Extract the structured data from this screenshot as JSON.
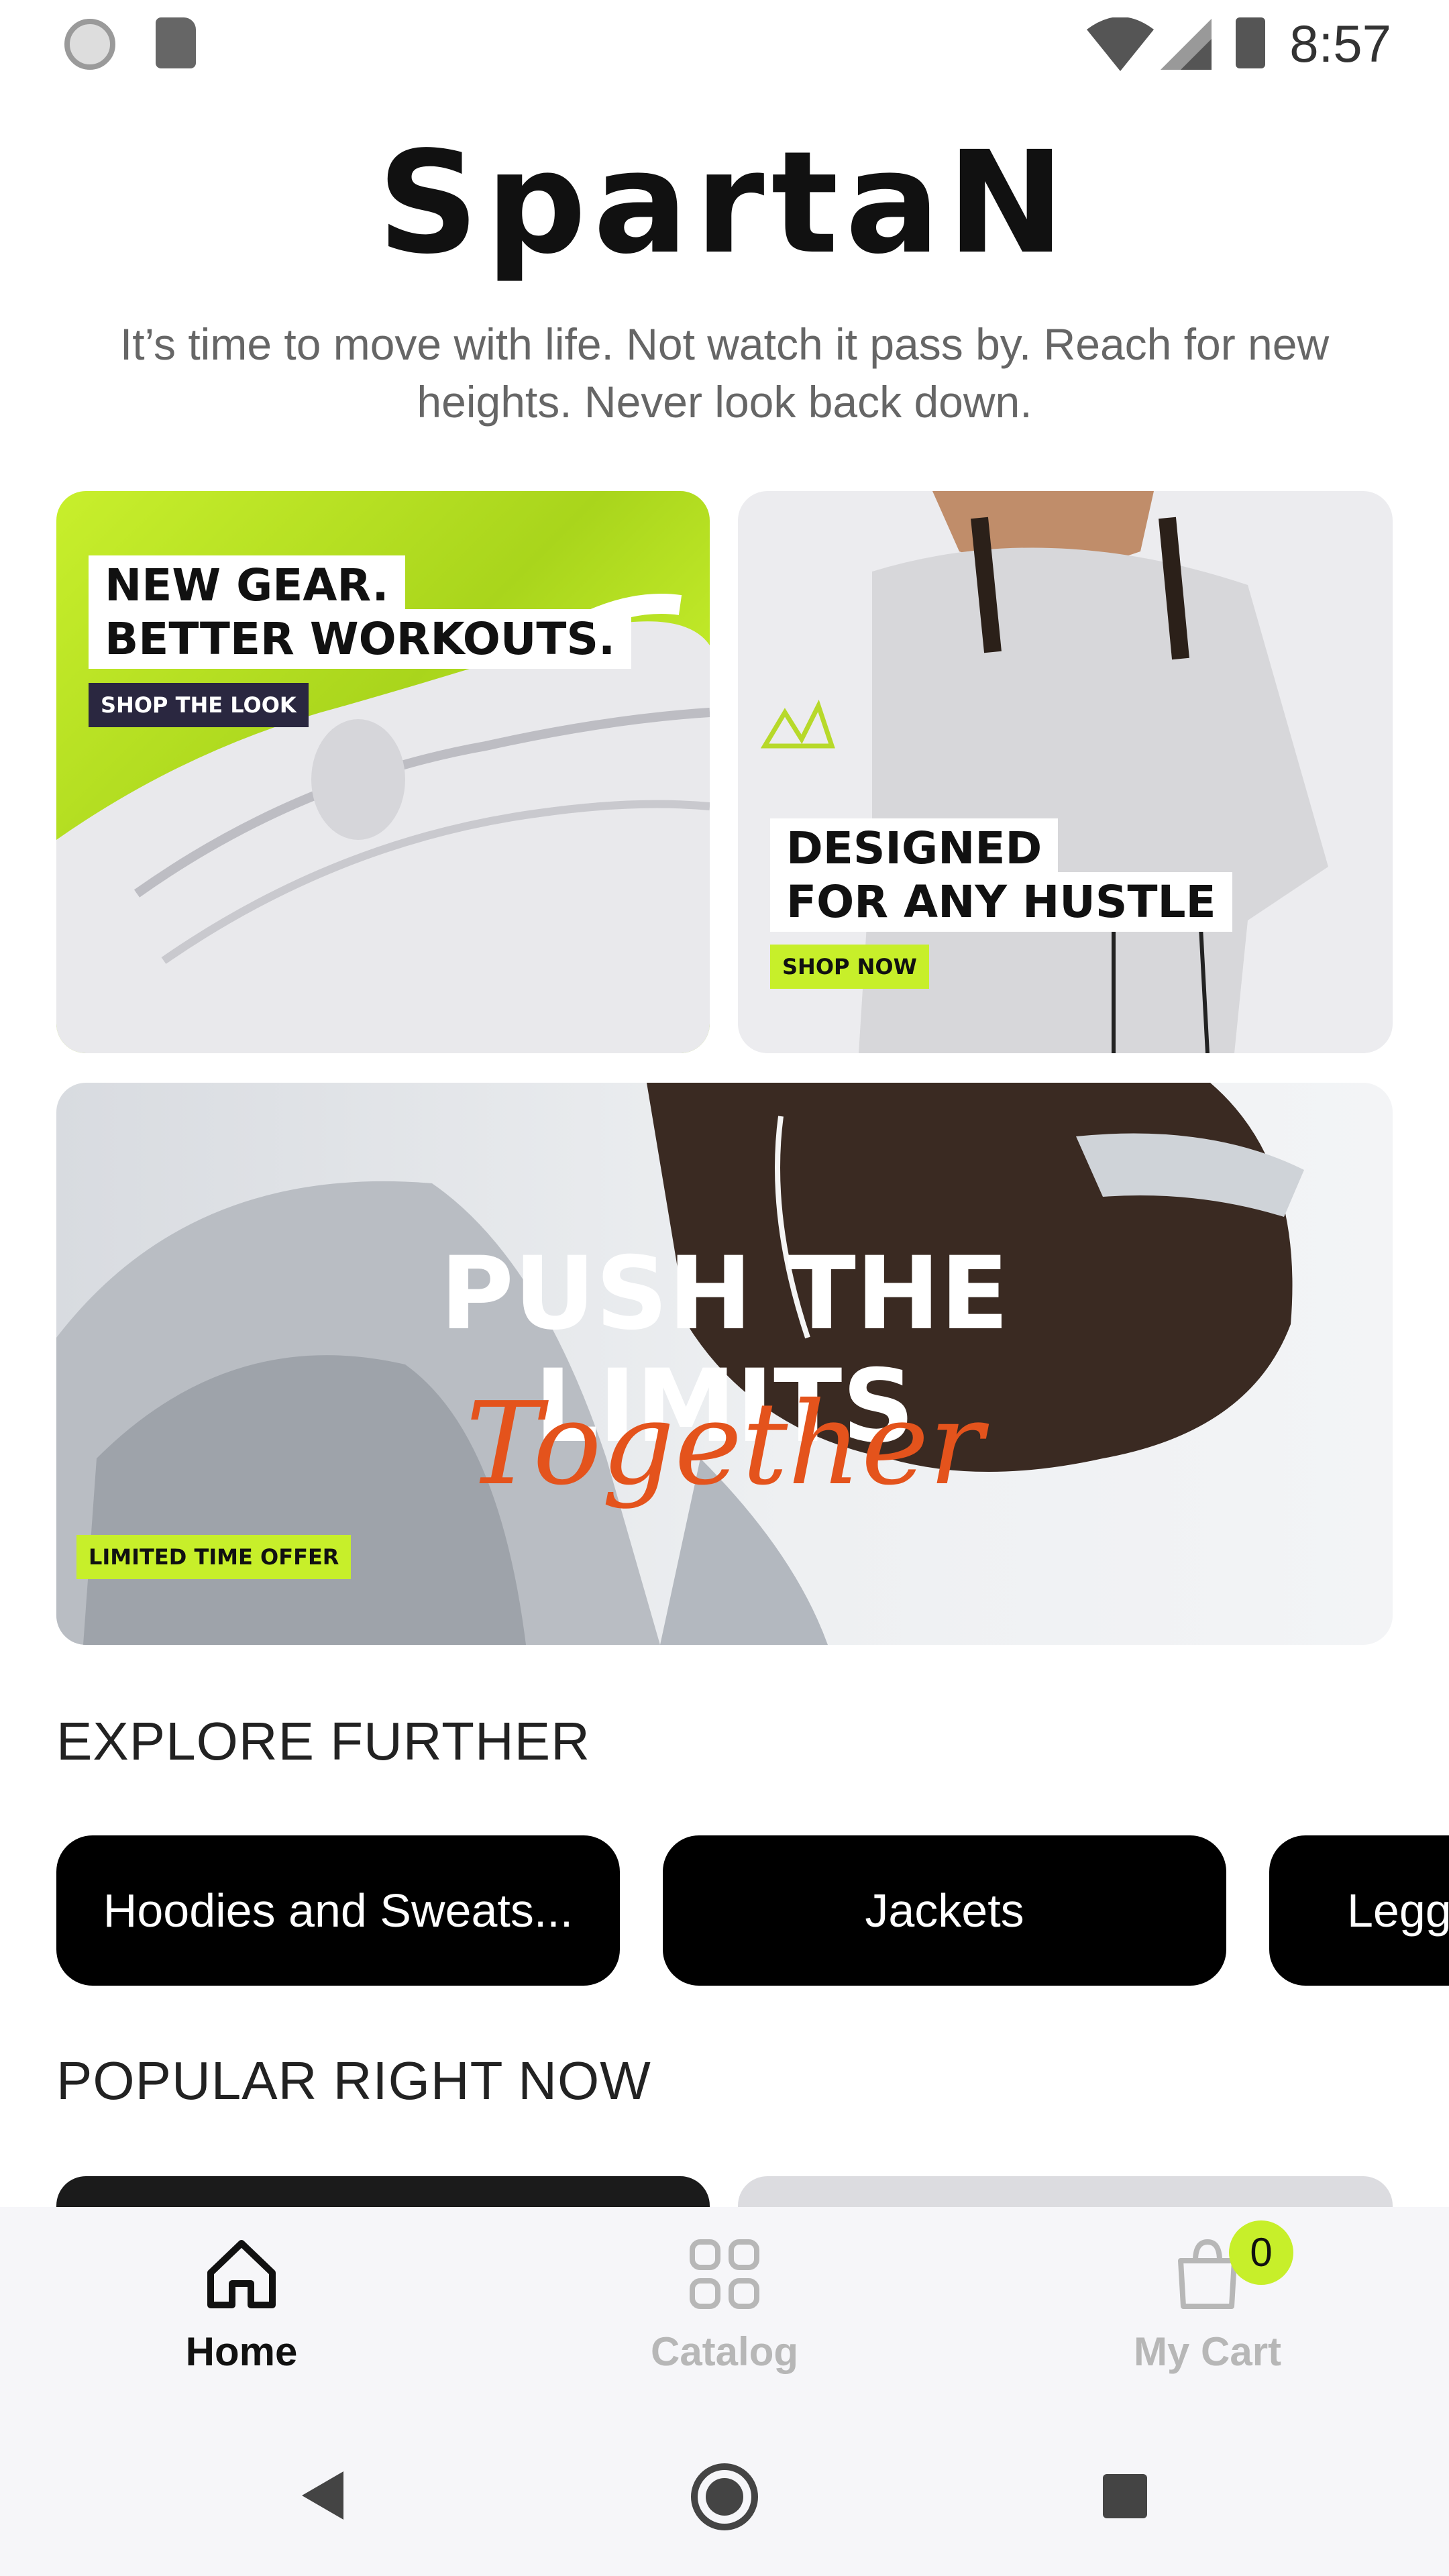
{
  "status_bar": {
    "time": "8:57"
  },
  "brand": {
    "logo_text": "SpartaN",
    "tagline": "It’s time to move with life. Not watch it pass by. Reach for new heights. Never look back down."
  },
  "banners": {
    "gear": {
      "line1": "NEW GEAR.",
      "line2": "BETTER WORKOUTS.",
      "cta": "SHOP THE LOOK"
    },
    "hustle": {
      "line1": "DESIGNED",
      "line2": "FOR ANY HUSTLE",
      "cta": "SHOP NOW"
    },
    "push": {
      "line1": "PUSH THE",
      "line2": "LIMITS",
      "script": "Together",
      "cta": "LIMITED TIME OFFER"
    }
  },
  "explore": {
    "title": "EXPLORE FURTHER",
    "categories": [
      "Hoodies and Sweats...",
      "Jackets",
      "Legg"
    ]
  },
  "popular": {
    "title": "POPULAR RIGHT NOW"
  },
  "bottom_nav": {
    "home": "Home",
    "catalog": "Catalog",
    "cart": "My Cart",
    "cart_count": "0"
  },
  "colors": {
    "accent": "#c7ef2a",
    "script": "#e4531c",
    "nav_active": "#111111",
    "nav_inactive": "#b7b7b7"
  }
}
